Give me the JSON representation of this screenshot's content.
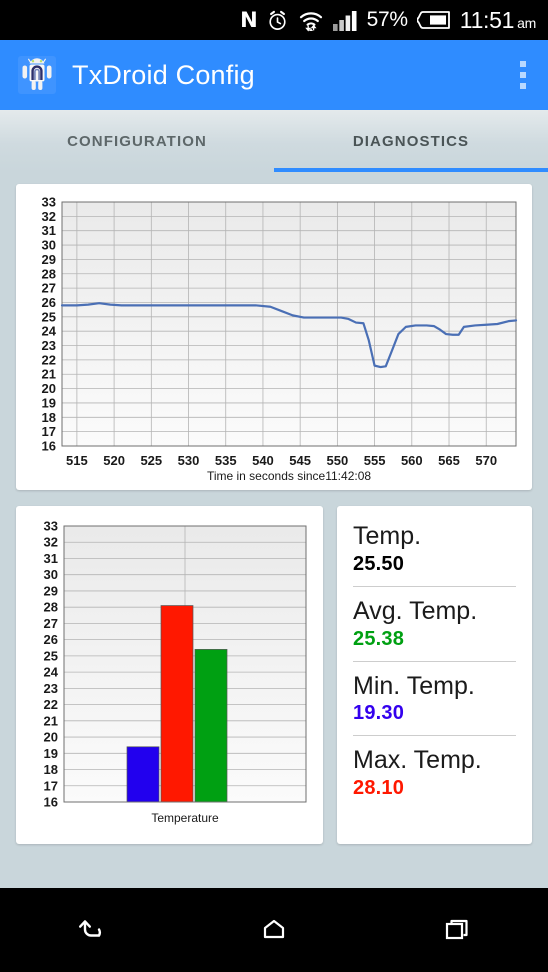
{
  "statusbar": {
    "icons": [
      "nfc-icon",
      "alarm-clock-icon",
      "wifi-icon",
      "cellular-signal-icon"
    ],
    "nfc_glyph": "N",
    "battery_percent": "57%",
    "time": "11:51",
    "ampm": "am"
  },
  "appbar": {
    "logo": "android-robot-icon",
    "title": "TxDroid Config",
    "overflow": "overflow-menu-icon",
    "color": "#2f8cff"
  },
  "tabs": [
    {
      "label": "CONFIGURATION",
      "active": false
    },
    {
      "label": "DIAGNOSTICS",
      "active": true
    }
  ],
  "stats": [
    {
      "label": "Temp.",
      "value": "25.50",
      "color": "#000000"
    },
    {
      "label": "Avg. Temp.",
      "value": "25.38",
      "color": "#00a012"
    },
    {
      "label": "Min. Temp.",
      "value": "19.30",
      "color": "#3300ee"
    },
    {
      "label": "Max. Temp.",
      "value": "28.10",
      "color": "#ff1800"
    }
  ],
  "navbar": {
    "back": "back-icon",
    "home": "home-icon",
    "recents": "recent-apps-icon"
  },
  "chart_data": [
    {
      "type": "line",
      "title": "",
      "xlabel": "Time in seconds since11:42:08",
      "ylabel": "",
      "xlim": [
        513,
        574
      ],
      "ylim": [
        16,
        33
      ],
      "xticks": [
        515,
        520,
        525,
        530,
        535,
        540,
        545,
        550,
        555,
        560,
        565,
        570
      ],
      "yticks": [
        16,
        17,
        18,
        19,
        20,
        21,
        22,
        23,
        24,
        25,
        26,
        27,
        28,
        29,
        30,
        31,
        32,
        33
      ],
      "grid": true,
      "legend": "none",
      "line_color": "#4a6fb5",
      "series": [
        {
          "name": "Temperature",
          "x": [
            513,
            515,
            516.5,
            518,
            519.5,
            521,
            525,
            530,
            535,
            539,
            541,
            542.5,
            544,
            545.5,
            548,
            550.5,
            551.5,
            552.5,
            553.5,
            554.2,
            555,
            555.8,
            556.5,
            557.3,
            558.2,
            559.2,
            560.5,
            562,
            563,
            563.8,
            564.6,
            565.5,
            566.3,
            567,
            568.5,
            570,
            571.5,
            573,
            574
          ],
          "y": [
            25.8,
            25.8,
            25.85,
            25.95,
            25.85,
            25.8,
            25.8,
            25.8,
            25.8,
            25.8,
            25.7,
            25.4,
            25.1,
            24.95,
            24.95,
            24.95,
            24.85,
            24.6,
            24.55,
            23.4,
            21.6,
            21.5,
            21.55,
            22.6,
            23.8,
            24.3,
            24.4,
            24.4,
            24.35,
            24.1,
            23.8,
            23.75,
            23.75,
            24.3,
            24.4,
            24.45,
            24.5,
            24.7,
            24.75
          ]
        }
      ]
    },
    {
      "type": "bar",
      "title": "",
      "xlabel": "Temperature",
      "ylabel": "",
      "ylim": [
        16,
        33
      ],
      "yticks": [
        16,
        17,
        18,
        19,
        20,
        21,
        22,
        23,
        24,
        25,
        26,
        27,
        28,
        29,
        30,
        31,
        32,
        33
      ],
      "grid": true,
      "legend": "none",
      "categories": [
        "Min",
        "Max",
        "Avg"
      ],
      "values": [
        19.4,
        28.1,
        25.4
      ],
      "colors": [
        "#2200ee",
        "#ff1800",
        "#00a012"
      ]
    }
  ]
}
